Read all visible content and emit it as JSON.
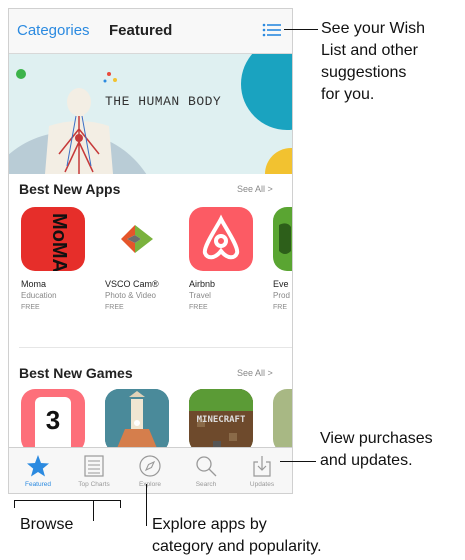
{
  "nav": {
    "categories": "Categories",
    "title": "Featured"
  },
  "banner": {
    "title": "THE HUMAN BODY"
  },
  "sections": [
    {
      "title": "Best New Apps",
      "see_all": "See All >",
      "apps": [
        {
          "name": "Moma",
          "category": "Education",
          "price": "FREE",
          "icon": "moma-icon"
        },
        {
          "name": "VSCO Cam®",
          "category": "Photo & Video",
          "price": "FREE",
          "icon": "vsco-icon"
        },
        {
          "name": "Airbnb",
          "category": "Travel",
          "price": "FREE",
          "icon": "airbnb-icon"
        },
        {
          "name": "Eve",
          "category": "Prod",
          "price": "FRE",
          "icon": "evernote-icon"
        }
      ]
    },
    {
      "title": "Best New Games",
      "see_all": "See All >",
      "apps": [
        {
          "icon": "threes-icon",
          "name": "",
          "category": "",
          "price": ""
        },
        {
          "icon": "monument-valley-icon",
          "name": "",
          "category": "",
          "price": ""
        },
        {
          "icon": "minecraft-icon",
          "minecraft_text": "MINECRAFT"
        },
        {
          "icon": "game-icon",
          "name": "",
          "category": "",
          "price": ""
        }
      ]
    }
  ],
  "threes_digit": "3",
  "tabs": [
    {
      "label": "Featured",
      "icon": "star-icon",
      "active": true
    },
    {
      "label": "Top Charts",
      "icon": "list-icon"
    },
    {
      "label": "Explore",
      "icon": "compass-icon"
    },
    {
      "label": "Search",
      "icon": "magnifier-icon"
    },
    {
      "label": "Updates",
      "icon": "download-icon"
    }
  ],
  "callouts": {
    "wishlist": [
      "See your Wish",
      "List and other",
      "suggestions",
      "for you."
    ],
    "updates": [
      "View purchases",
      "and updates."
    ],
    "browse": "Browse",
    "explore": [
      "Explore apps by",
      "category and popularity."
    ]
  },
  "colors": {
    "accent": "#2b8ae0",
    "moma": "#e62e2a",
    "airbnb": "#fc5b64",
    "evernote": "#5aa532"
  }
}
